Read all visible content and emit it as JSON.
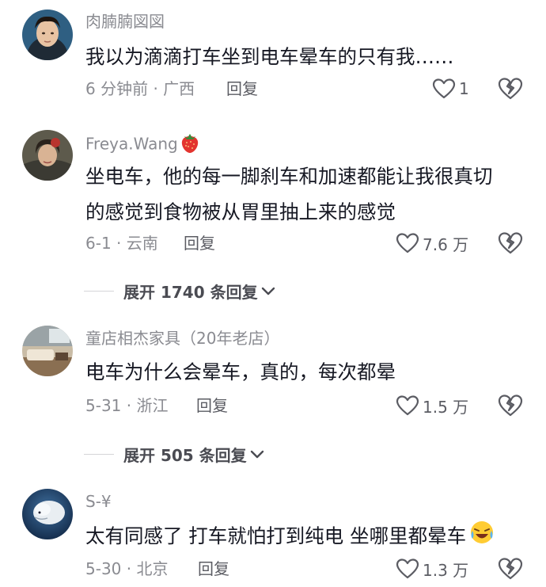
{
  "comments": [
    {
      "username": "肉腩腩図図",
      "text_lines": [
        "我以为滴滴打车坐到电车晕车的只有我……"
      ],
      "meta": "6 分钟前 · 广西",
      "reply_label": "回复",
      "likes": "1",
      "avatar_icon": "man-portrait-avatar"
    },
    {
      "username": "Freya.Wang",
      "username_emoji": "strawberry",
      "text_lines": [
        "坐电车，他的每一脚刹车和加速都能让我很真切",
        "的感觉到食物被从胃里抽上来的感觉"
      ],
      "meta": "6-1 · 云南",
      "reply_label": "回复",
      "likes": "7.6 万",
      "expand_label": "展开 1740 条回复",
      "avatar_icon": "woman-portrait-avatar"
    },
    {
      "username": "童店相杰家具（20年老店）",
      "text_lines": [
        "电车为什么会晕车，真的，每次都晕"
      ],
      "meta": "5-31 · 浙江",
      "reply_label": "回复",
      "likes": "1.5 万",
      "expand_label": "展开 505 条回复",
      "avatar_icon": "living-room-avatar"
    },
    {
      "username": "S-¥",
      "text_lines": [
        "太有同感了 打车就怕打到纯电 坐哪里都晕车"
      ],
      "text_emoji": "laughing-crying",
      "meta": "5-30 · 北京",
      "reply_label": "回复",
      "likes": "1.3 万",
      "avatar_icon": "beluga-avatar"
    }
  ],
  "colors": {
    "text": "#161823",
    "secondary": "#8a8b91",
    "action": "#5b5c63"
  }
}
